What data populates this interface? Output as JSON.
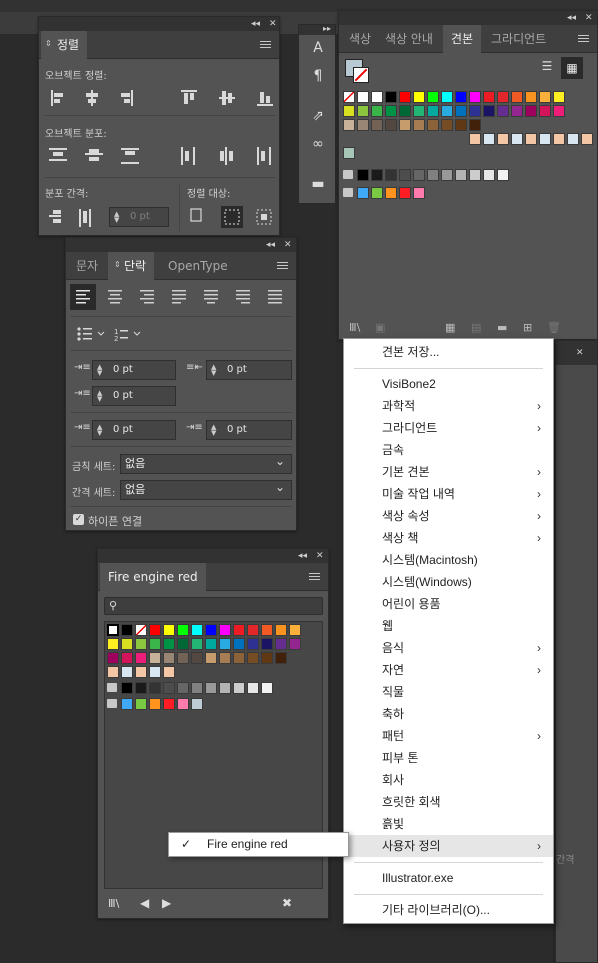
{
  "align_panel": {
    "tab": "정렬",
    "align_objects": "오브젝트 정렬:",
    "distribute_objects": "오브젝트 분포:",
    "distribute_spacing": "분포 간격:",
    "align_to": "정렬 대상:",
    "spacing_value": "0 pt"
  },
  "paragraph_panel": {
    "tabs": [
      "문자",
      "단락",
      "OpenType"
    ],
    "active_tab": "단락",
    "left_indent": "0 pt",
    "right_indent": "0 pt",
    "first_line_indent": "0 pt",
    "space_before": "0 pt",
    "space_after": "0 pt",
    "kinsoku_label": "금칙 세트:",
    "kinsoku_value": "없음",
    "mojikumi_label": "간격 세트:",
    "mojikumi_value": "없음",
    "hyphenate_label": "하이픈 연결"
  },
  "library_panel": {
    "title": "Fire engine red",
    "search_placeholder": ""
  },
  "swatches_panel": {
    "tabs": [
      "색상",
      "색상 안내",
      "견본",
      "그라디언트"
    ],
    "active_tab": "견본"
  },
  "menu": {
    "items": [
      {
        "label": "견본 저장...",
        "submenu": false
      },
      {
        "sep": true
      },
      {
        "label": "VisiBone2",
        "submenu": false
      },
      {
        "label": "과학적",
        "submenu": true
      },
      {
        "label": "그라디언트",
        "submenu": true
      },
      {
        "label": "금속",
        "submenu": false
      },
      {
        "label": "기본 견본",
        "submenu": true
      },
      {
        "label": "미술 작업 내역",
        "submenu": true
      },
      {
        "label": "색상 속성",
        "submenu": true
      },
      {
        "label": "색상 책",
        "submenu": true
      },
      {
        "label": "시스템(Macintosh)",
        "submenu": false
      },
      {
        "label": "시스템(Windows)",
        "submenu": false
      },
      {
        "label": "어린이 용품",
        "submenu": false
      },
      {
        "label": "웹",
        "submenu": false
      },
      {
        "label": "음식",
        "submenu": true
      },
      {
        "label": "자연",
        "submenu": true
      },
      {
        "label": "직물",
        "submenu": false
      },
      {
        "label": "축하",
        "submenu": false
      },
      {
        "label": "패턴",
        "submenu": true
      },
      {
        "label": "피부 톤",
        "submenu": false
      },
      {
        "label": "회사",
        "submenu": false
      },
      {
        "label": "흐릿한 회색",
        "submenu": false
      },
      {
        "label": "흙빛",
        "submenu": false
      },
      {
        "label": "사용자 정의",
        "submenu": true,
        "highlight": true
      },
      {
        "sep": true
      },
      {
        "label": "Illustrator.exe",
        "submenu": false
      },
      {
        "sep": true
      },
      {
        "label": "기타 라이브러리(O)...",
        "submenu": false
      }
    ]
  },
  "submenu": {
    "check": "✓",
    "label": "Fire engine red"
  },
  "right_panel_text": "간격",
  "colors": {
    "panel": "#535353",
    "header": "#323232",
    "tabbar": "#3f3f3f",
    "menu_bg": "#ffffff",
    "menu_hover": "#e6e6e6"
  },
  "swatch_rows": {
    "main": [
      "#ffffff",
      "#000000",
      "#ff0000",
      "#ffff00",
      "#00ff00",
      "#00ffff",
      "#0000ff",
      "#ff00ff",
      "#ed1c24",
      "#e3262a",
      "#f15a24",
      "#f7931e",
      "#fbb03b",
      "#fcee21",
      "#d9e021",
      "#8cc63f",
      "#39b54a",
      "#009245",
      "#006837",
      "#22b573",
      "#00a99d",
      "#29abe2",
      "#0071bc",
      "#2e3192",
      "#1b1464",
      "#662d91",
      "#93278f",
      "#9e005d",
      "#d4145a",
      "#ed1e79",
      "#c7b299",
      "#998675",
      "#736357",
      "#534741",
      "#c69c6d",
      "#a67c52",
      "#8c6239",
      "#754c24",
      "#603813",
      "#42210b"
    ],
    "grays": [
      "#000000",
      "#1a1a1a",
      "#333333",
      "#4d4d4d",
      "#666666",
      "#808080",
      "#999999",
      "#b3b3b3",
      "#cccccc",
      "#e6e6e6",
      "#f2f2f2"
    ],
    "group": [
      "#3fa9f5",
      "#7ac943",
      "#ff931e",
      "#ff1d25",
      "#ff7bac",
      "#bdccd4"
    ]
  }
}
